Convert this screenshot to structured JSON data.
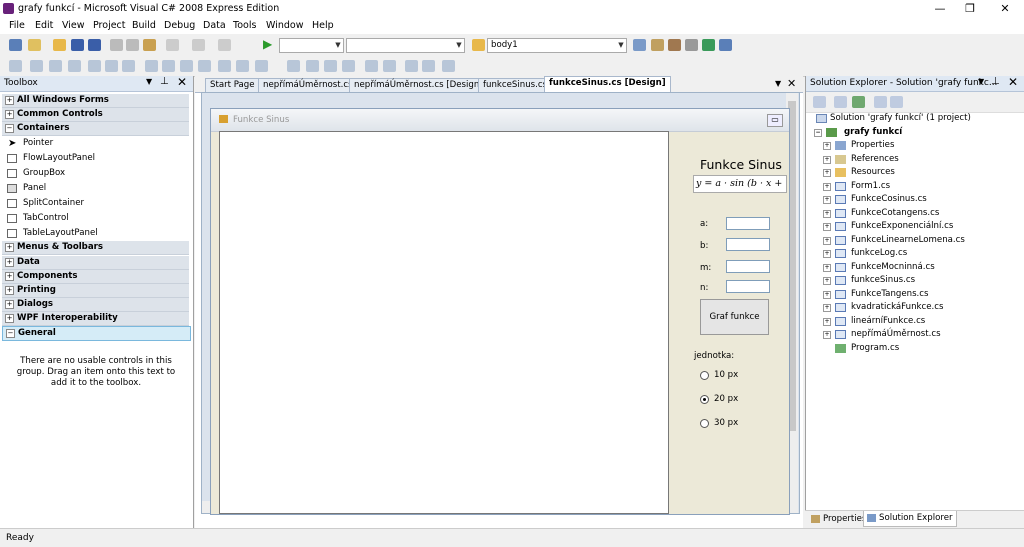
{
  "window": {
    "title": "grafy funkcí - Microsoft Visual C# 2008 Express Edition",
    "min": "—",
    "restore": "❐",
    "close": "✕"
  },
  "menu": [
    "File",
    "Edit",
    "View",
    "Project",
    "Build",
    "Debug",
    "Data",
    "Tools",
    "Window",
    "Help"
  ],
  "toolbar": {
    "combo1": "",
    "combo2": "",
    "target": "body1"
  },
  "toolbox": {
    "title": "Toolbox",
    "categories_top": [
      "All Windows Forms",
      "Common Controls",
      "Containers"
    ],
    "tools": [
      "Pointer",
      "FlowLayoutPanel",
      "GroupBox",
      "Panel",
      "SplitContainer",
      "TabControl",
      "TableLayoutPanel"
    ],
    "categories_bottom": [
      "Menus & Toolbars",
      "Data",
      "Components",
      "Printing",
      "Dialogs",
      "WPF Interoperability",
      "General"
    ],
    "empty_msg": "There are no usable controls in this group. Drag an item onto this text to add it to the toolbox."
  },
  "tabs": [
    "Start Page",
    "nepřímáÚměrnost.cs",
    "nepřímáÚměrnost.cs [Design]",
    "funkceSinus.cs",
    "funkceSinus.cs [Design]"
  ],
  "form": {
    "title": "Funkce Sinus",
    "heading": "Funkce Sinus",
    "formula": "y = a · sin (b · x + m",
    "labels": [
      "a:",
      "b:",
      "m:",
      "n:"
    ],
    "button": "Graf funkce",
    "unit_label": "jednotka:",
    "radios": [
      "10 px",
      "20 px",
      "30 px"
    ],
    "selected_radio": 1
  },
  "solution": {
    "title": "Solution Explorer - Solution 'grafy funkc...",
    "root": "Solution 'grafy funkcí' (1 project)",
    "project": "grafy funkcí",
    "items": [
      "Properties",
      "References",
      "Resources",
      "Form1.cs",
      "FunkceCosinus.cs",
      "FunkceCotangens.cs",
      "FunkceExponenciální.cs",
      "FunkceLinearneLomena.cs",
      "funkceLog.cs",
      "FunkceMocninná.cs",
      "funkceSinus.cs",
      "FunkceTangens.cs",
      "kvadratickáFunkce.cs",
      "lineárníFunkce.cs",
      "nepřímáÚměrnost.cs",
      "Program.cs"
    ],
    "bottom_tabs": [
      "Properties",
      "Solution Explorer"
    ]
  },
  "status": "Ready",
  "colors": {
    "accent": "#68217a",
    "panel_header": "#dfe8f3",
    "selected_category": "#d5ecf7"
  }
}
